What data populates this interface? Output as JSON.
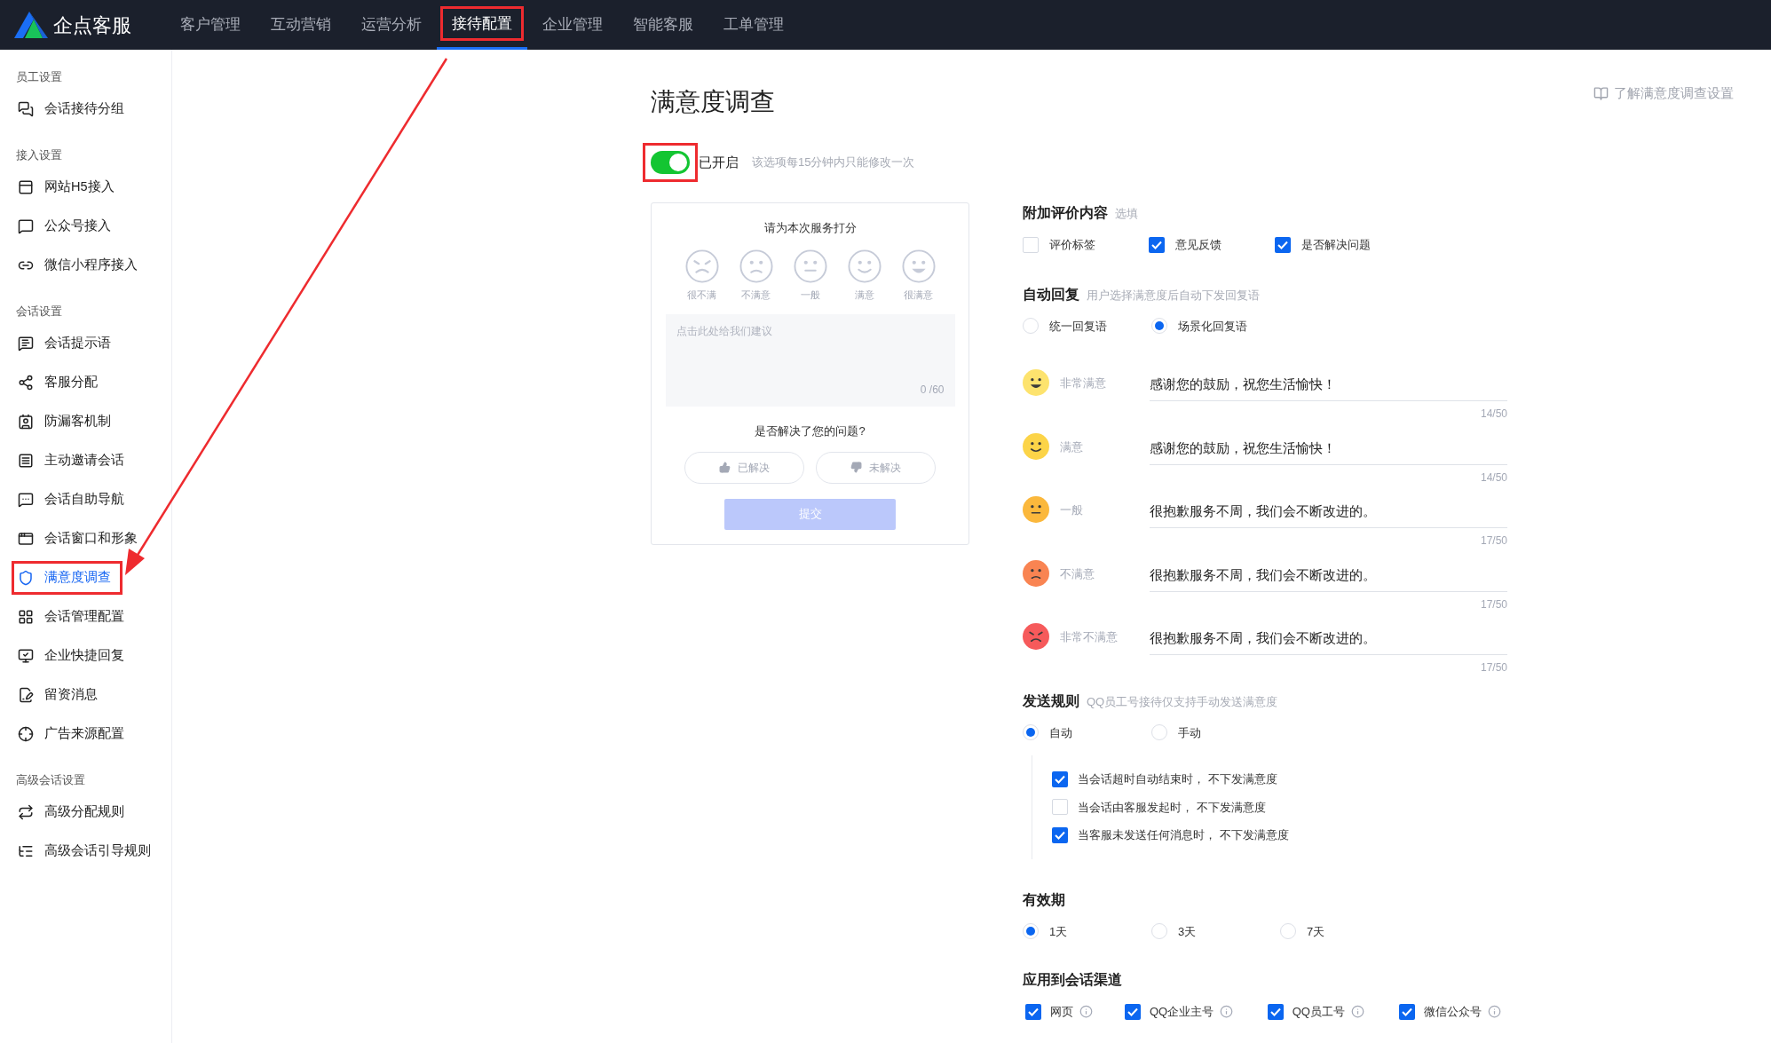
{
  "app": {
    "logo_text": "企点客服"
  },
  "nav": [
    {
      "label": "客户管理",
      "selected": false,
      "highlighted": false
    },
    {
      "label": "互动营销",
      "selected": false,
      "highlighted": false
    },
    {
      "label": "运营分析",
      "selected": false,
      "highlighted": false
    },
    {
      "label": "接待配置",
      "selected": true,
      "highlighted": true
    },
    {
      "label": "企业管理",
      "selected": false,
      "highlighted": false
    },
    {
      "label": "智能客服",
      "selected": false,
      "highlighted": false
    },
    {
      "label": "工单管理",
      "selected": false,
      "highlighted": false
    }
  ],
  "sidebar": [
    {
      "heading": "员工设置",
      "items": [
        {
          "label": "会话接待分组",
          "selected": false,
          "highlighted": false
        }
      ]
    },
    {
      "heading": "接入设置",
      "items": [
        {
          "label": "网站H5接入",
          "selected": false,
          "highlighted": false
        },
        {
          "label": "公众号接入",
          "selected": false,
          "highlighted": false
        },
        {
          "label": "微信小程序接入",
          "selected": false,
          "highlighted": false
        }
      ]
    },
    {
      "heading": "会话设置",
      "items": [
        {
          "label": "会话提示语",
          "selected": false,
          "highlighted": false
        },
        {
          "label": "客服分配",
          "selected": false,
          "highlighted": false
        },
        {
          "label": "防漏客机制",
          "selected": false,
          "highlighted": false
        },
        {
          "label": "主动邀请会话",
          "selected": false,
          "highlighted": false
        },
        {
          "label": "会话自助导航",
          "selected": false,
          "highlighted": false
        },
        {
          "label": "会话窗口和形象",
          "selected": false,
          "highlighted": false
        },
        {
          "label": "满意度调查",
          "selected": true,
          "highlighted": true
        },
        {
          "label": "会话管理配置",
          "selected": false,
          "highlighted": false
        },
        {
          "label": "企业快捷回复",
          "selected": false,
          "highlighted": false
        },
        {
          "label": "留资消息",
          "selected": false,
          "highlighted": false
        },
        {
          "label": "广告来源配置",
          "selected": false,
          "highlighted": false
        }
      ]
    },
    {
      "heading": "高级会话设置",
      "items": [
        {
          "label": "高级分配规则",
          "selected": false,
          "highlighted": false
        },
        {
          "label": "高级会话引导规则",
          "selected": false,
          "highlighted": false
        }
      ]
    }
  ],
  "help_link": "了解满意度调查设置",
  "page_title": "满意度调查",
  "toggle": {
    "on": true,
    "label": "已开启",
    "hint": "该选项每15分钟内只能修改一次",
    "highlighted": true
  },
  "preview": {
    "title": "请为本次服务打分",
    "ratings": [
      {
        "label": "很不满",
        "kind": "very_unhappy"
      },
      {
        "label": "不满意",
        "kind": "unhappy"
      },
      {
        "label": "一般",
        "kind": "neutral"
      },
      {
        "label": "满意",
        "kind": "happy"
      },
      {
        "label": "很满意",
        "kind": "very_happy"
      }
    ],
    "suggestion_placeholder": "点击此处给我们建议",
    "counter": "0 /60",
    "question": "是否解决了您的问题?",
    "buttons": [
      {
        "label": "已解决",
        "kind": "up"
      },
      {
        "label": "未解决",
        "kind": "down"
      }
    ],
    "submit": "提交"
  },
  "extra": {
    "title": "附加评价内容",
    "hint": "选填",
    "options": [
      {
        "label": "评价标签",
        "checked": false
      },
      {
        "label": "意见反馈",
        "checked": true
      },
      {
        "label": "是否解决问题",
        "checked": true
      }
    ]
  },
  "auto_reply": {
    "title": "自动回复",
    "hint": "用户选择满意度后自动下发回复语",
    "modes": [
      {
        "label": "统一回复语",
        "selected": false
      },
      {
        "label": "场景化回复语",
        "selected": true
      }
    ],
    "replies": [
      {
        "kind": "very_happy",
        "color": "#fde36e",
        "label": "非常满意",
        "value": "感谢您的鼓励，祝您生活愉快！",
        "counter": "14/50"
      },
      {
        "kind": "happy",
        "color": "#fcd448",
        "label": "满意",
        "value": "感谢您的鼓励，祝您生活愉快！",
        "counter": "14/50"
      },
      {
        "kind": "neutral",
        "color": "#fbb83c",
        "label": "一般",
        "value": "很抱歉服务不周，我们会不断改进的。",
        "counter": "17/50"
      },
      {
        "kind": "unhappy",
        "color": "#f98452",
        "label": "不满意",
        "value": "很抱歉服务不周，我们会不断改进的。",
        "counter": "17/50"
      },
      {
        "kind": "very_unhappy",
        "color": "#f65a5b",
        "label": "非常不满意",
        "value": "很抱歉服务不周，我们会不断改进的。",
        "counter": "17/50"
      }
    ]
  },
  "send_rule": {
    "title": "发送规则",
    "hint": "QQ员工号接待仅支持手动发送满意度",
    "modes": [
      {
        "label": "自动",
        "selected": true
      },
      {
        "label": "手动",
        "selected": false
      }
    ],
    "conditions": [
      {
        "label": "当会话超时自动结束时， 不下发满意度",
        "checked": true
      },
      {
        "label": "当会话由客服发起时， 不下发满意度",
        "checked": false
      },
      {
        "label": "当客服未发送任何消息时， 不下发满意度",
        "checked": true
      }
    ]
  },
  "validity": {
    "title": "有效期",
    "options": [
      {
        "label": "1天",
        "selected": true
      },
      {
        "label": "3天",
        "selected": false
      },
      {
        "label": "7天",
        "selected": false
      }
    ]
  },
  "channels": {
    "title": "应用到会话渠道",
    "options": [
      {
        "label": "网页",
        "checked": true
      },
      {
        "label": "QQ企业主号",
        "checked": true
      },
      {
        "label": "QQ员工号",
        "checked": true
      },
      {
        "label": "微信公众号",
        "checked": true
      }
    ]
  }
}
